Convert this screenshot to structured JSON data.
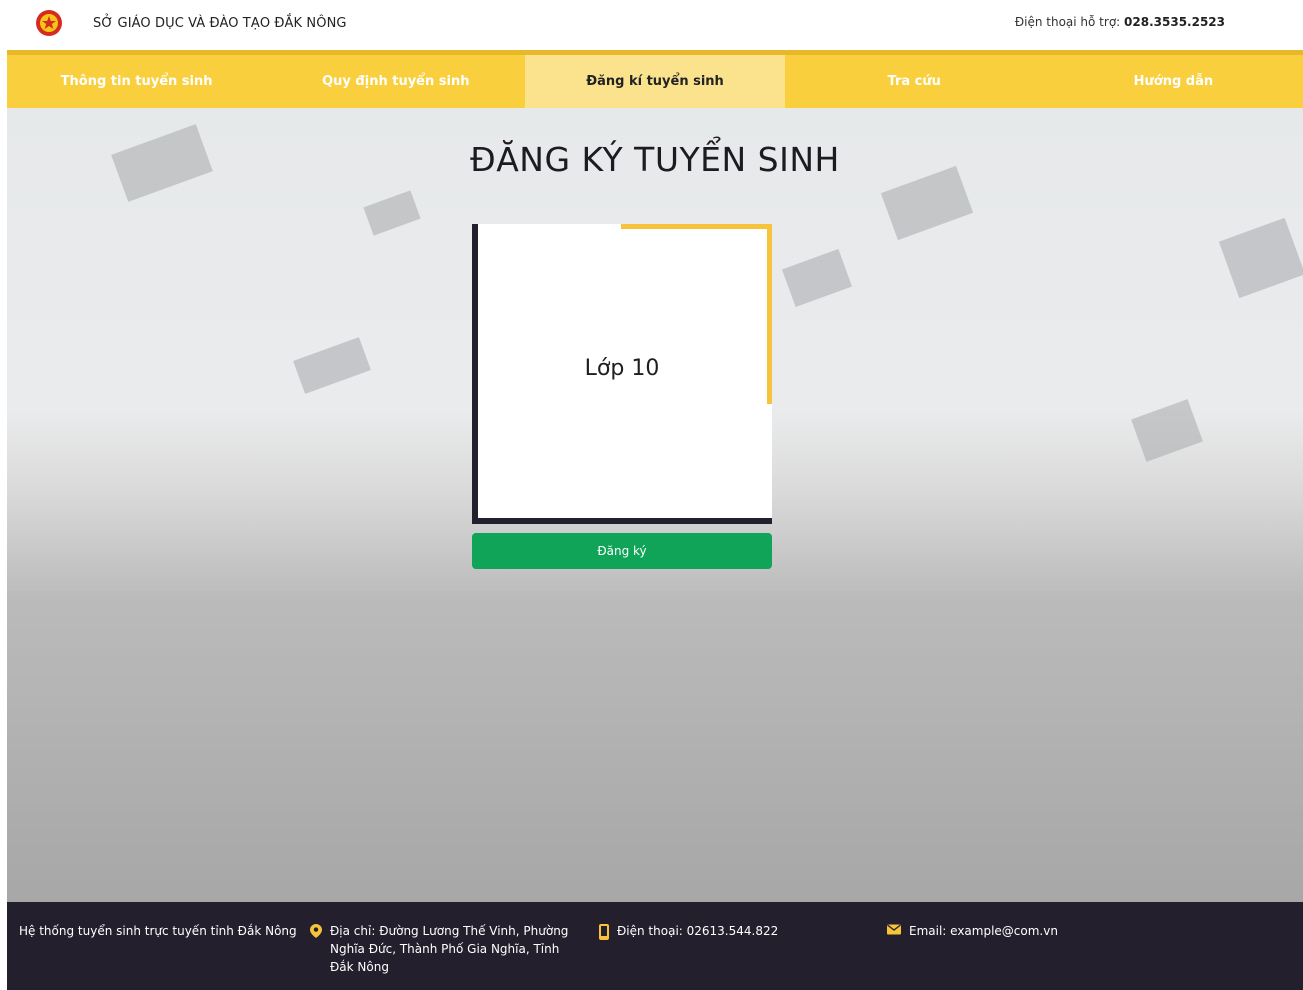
{
  "header": {
    "org_name": "SỞ GIÁO DỤC VÀ ĐÀO TẠO ĐẮK NÔNG",
    "support_label": "Điện thoại hỗ trợ:",
    "support_phone": "028.3535.2523"
  },
  "nav": {
    "items": [
      {
        "label": "Thông tin tuyển sinh"
      },
      {
        "label": "Quy định tuyển sinh"
      },
      {
        "label": "Đăng kí tuyển sinh"
      },
      {
        "label": "Tra cứu"
      },
      {
        "label": "Hướng dẫn"
      }
    ],
    "active_index": 2
  },
  "main": {
    "title": "ĐĂNG KÝ TUYỂN SINH",
    "card_label": "Lớp 10",
    "register_button": "Đăng ký"
  },
  "footer": {
    "system_name": "Hệ thống tuyển sinh trực tuyến tỉnh Đắk Nông",
    "address": "Địa chỉ: Đường Lương Thế Vinh, Phường Nghĩa Đức, Thành Phố Gia Nghĩa, Tỉnh Đắk Nông",
    "phone": "Điện thoại: 02613.544.822",
    "email": "Email: example@com.vn"
  },
  "colors": {
    "nav_bg": "#f9cf3e",
    "nav_active_bg": "#fbe38e",
    "accent_yellow": "#f6c33a",
    "dark": "#231f2c",
    "button_green": "#0fa457"
  },
  "icons": {
    "logo": "national-emblem-icon",
    "address": "map-pin-icon",
    "phone": "phone-icon",
    "email": "envelope-icon"
  }
}
